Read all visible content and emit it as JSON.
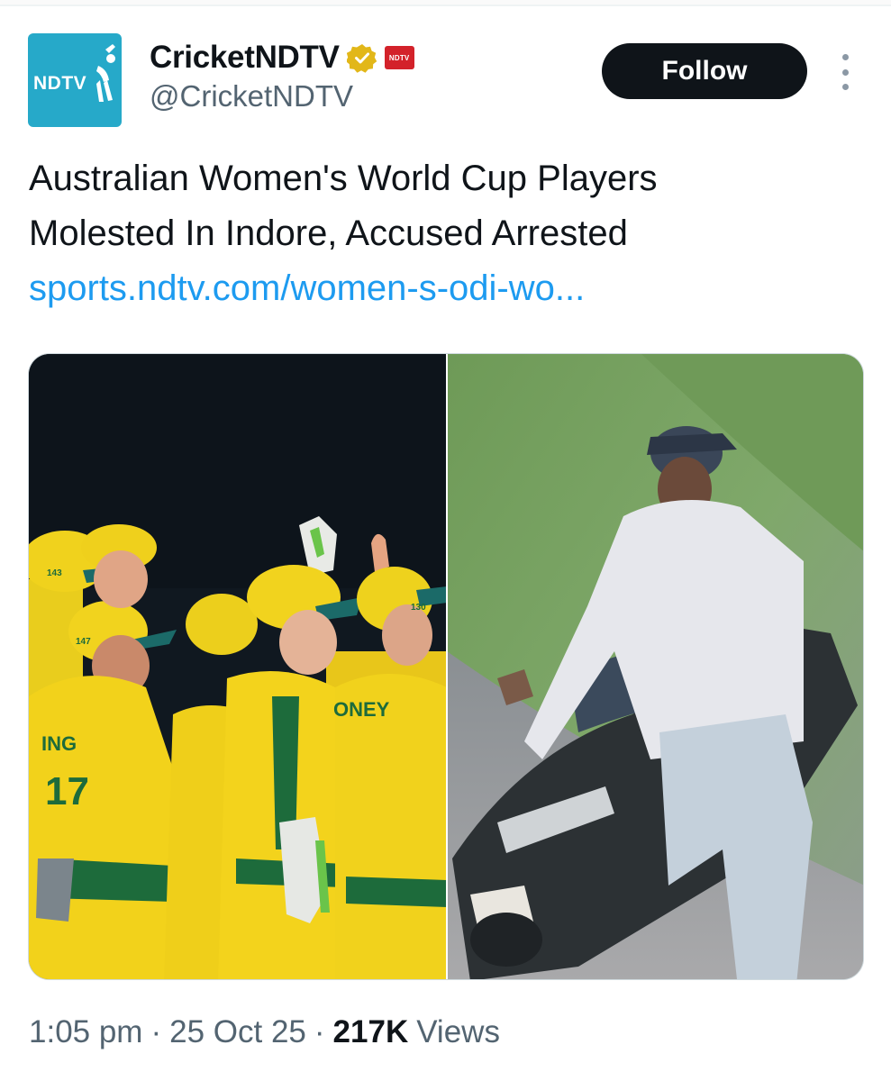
{
  "account": {
    "display_name": "CricketNDTV",
    "handle": "@CricketNDTV",
    "avatar_text": "NDTV",
    "badge_text": "NDTV"
  },
  "follow_label": "Follow",
  "tweet": {
    "line1": "Australian Women's World Cup Players",
    "line2": "Molested In Indore, Accused Arrested",
    "link": "sports.ndtv.com/women-s-odi-wo..."
  },
  "meta": {
    "time": "1:05 pm",
    "date": "25 Oct 25",
    "views_count": "217K",
    "views_label": "Views",
    "separator": "·"
  },
  "media_text": {
    "jersey_name_left": "ING",
    "jersey_number_left": "17",
    "jersey_name_right": "ONEY",
    "cap_number_1": "143",
    "cap_number_2": "147",
    "cap_number_3": "130"
  },
  "colors": {
    "text_primary": "#0f1419",
    "text_secondary": "#536471",
    "link": "#1d9bf0",
    "follow_bg": "#0f1419",
    "verified_gold": "#e2b719",
    "avatar_bg": "#26a9c9",
    "jersey_yellow": "#f2d21b",
    "jersey_green": "#1d6b3b"
  }
}
